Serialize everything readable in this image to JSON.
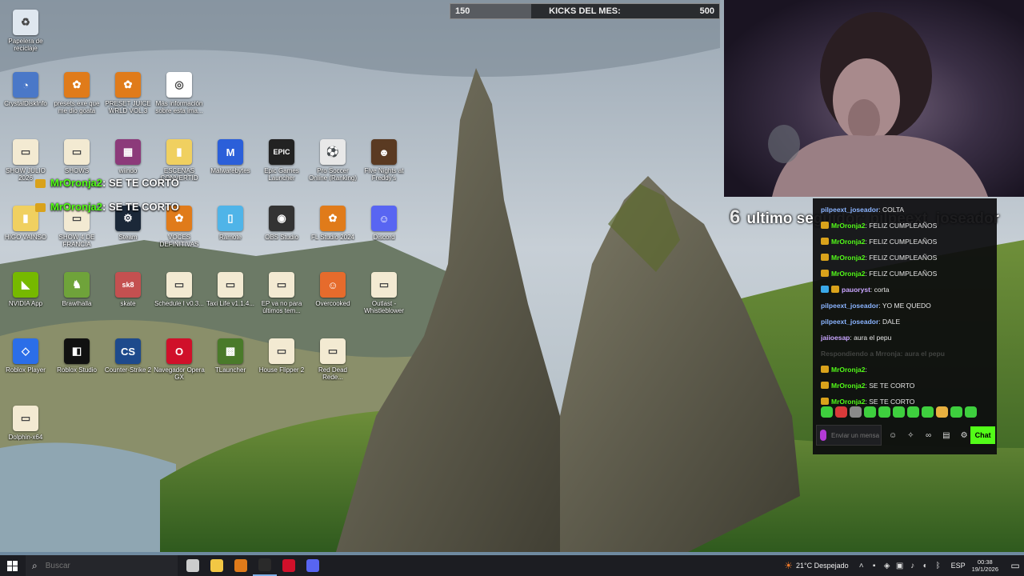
{
  "desktop": {
    "icons": [
      {
        "label": "Papelera de reciclaje",
        "icon": "recycle-bin-icon",
        "color": "#dfe7ef",
        "glyph": "♻"
      },
      {
        "label": "CrystalDiskInfo",
        "icon": "crystaldiskinfo-icon",
        "color": "#4a78c8",
        "glyph": "◔"
      },
      {
        "label": "presets.exe que me dio goata",
        "icon": "fl-studio-icon",
        "color": "#e07b1a",
        "glyph": "✿"
      },
      {
        "label": "PRESET JUICE WRLD VOL.3",
        "icon": "fl-studio-icon",
        "color": "#e07b1a",
        "glyph": "✿"
      },
      {
        "label": "Más información sobre esta ima...",
        "icon": "info-camera-icon",
        "color": "#ffffff",
        "glyph": "◎"
      },
      {
        "label": "SHOW JULIO 2026",
        "icon": "folder-icon",
        "color": "#f3ead2",
        "glyph": "▭"
      },
      {
        "label": "SHOWS",
        "icon": "folder-icon",
        "color": "#f3ead2",
        "glyph": "▭"
      },
      {
        "label": "wiindo",
        "icon": "winrar-icon",
        "color": "#8c3a7a",
        "glyph": "▦"
      },
      {
        "label": "ESCENAS CONVERTID",
        "icon": "folder-dark-icon",
        "color": "#f0d060",
        "glyph": "▮"
      },
      {
        "label": "Malwarebytes",
        "icon": "malwarebytes-icon",
        "color": "#2b5fd9",
        "glyph": "M"
      },
      {
        "label": "Epic Games Launcher",
        "icon": "epic-games-icon",
        "color": "#222222",
        "glyph": "EPIC"
      },
      {
        "label": "Pro Soccer Online (Ranking)",
        "icon": "soccer-ball-icon",
        "color": "#e8e8e8",
        "glyph": "⚽"
      },
      {
        "label": "Five Nights at Freddy's",
        "icon": "fnaf-icon",
        "color": "#5a3a22",
        "glyph": "☻"
      },
      {
        "label": "HIGO VAINSO",
        "icon": "folder-dark-icon",
        "color": "#f0d060",
        "glyph": "▮"
      },
      {
        "label": "SHOW 4 DE FRANCIA",
        "icon": "folder-icon",
        "color": "#f3ead2",
        "glyph": "▭"
      },
      {
        "label": "Steam",
        "icon": "steam-icon",
        "color": "#1b2838",
        "glyph": "⚙"
      },
      {
        "label": "VOCES DEFINITIVAS",
        "icon": "fl-studio-icon",
        "color": "#e07b1a",
        "glyph": "✿"
      },
      {
        "label": "Ramote",
        "icon": "app-icon",
        "color": "#4fb4e8",
        "glyph": "▯"
      },
      {
        "label": "OBS Studio",
        "icon": "obs-icon",
        "color": "#333333",
        "glyph": "◉"
      },
      {
        "label": "FL Studio 2024",
        "icon": "fl-studio-icon",
        "color": "#e07b1a",
        "glyph": "✿"
      },
      {
        "label": "Discord",
        "icon": "discord-icon",
        "color": "#5865f2",
        "glyph": "☺"
      },
      {
        "label": "NVIDIA App",
        "icon": "nvidia-icon",
        "color": "#76b900",
        "glyph": "◣"
      },
      {
        "label": "Brawlhalla",
        "icon": "brawlhalla-icon",
        "color": "#6fa33a",
        "glyph": "♞"
      },
      {
        "label": "skate",
        "icon": "skate-icon",
        "color": "#c45050",
        "glyph": "sk8"
      },
      {
        "label": "Schedule I v0.3...",
        "icon": "folder-icon",
        "color": "#f3ead2",
        "glyph": "▭"
      },
      {
        "label": "Taxi Life v1.1.4...",
        "icon": "folder-icon",
        "color": "#f3ead2",
        "glyph": "▭"
      },
      {
        "label": "EP va no para últimos tem...",
        "icon": "folder-icon",
        "color": "#f3ead2",
        "glyph": "▭"
      },
      {
        "label": "Overcooked",
        "icon": "overcooked-icon",
        "color": "#e66b2c",
        "glyph": "☺"
      },
      {
        "label": "Outlast - Whistleblower",
        "icon": "folder-icon",
        "color": "#f3ead2",
        "glyph": "▭"
      },
      {
        "label": "Roblox Player",
        "icon": "roblox-player-icon",
        "color": "#2b6ee8",
        "glyph": "◇"
      },
      {
        "label": "Roblox Studio",
        "icon": "roblox-studio-icon",
        "color": "#111111",
        "glyph": "◧"
      },
      {
        "label": "Counter-Strike 2",
        "icon": "counter-strike-icon",
        "color": "#1e4a8c",
        "glyph": "CS"
      },
      {
        "label": "Navegador Opera GX",
        "icon": "opera-gx-icon",
        "color": "#d0102a",
        "glyph": "O"
      },
      {
        "label": "TLauncher",
        "icon": "tlauncher-icon",
        "color": "#4a7a2a",
        "glyph": "▩"
      },
      {
        "label": "House Flipper 2",
        "icon": "folder-icon",
        "color": "#f3ead2",
        "glyph": "▭"
      },
      {
        "label": "Red Dead Rede...",
        "icon": "folder-icon",
        "color": "#f3ead2",
        "glyph": "▭"
      },
      {
        "label": "Dolphin-x64",
        "icon": "folder-icon",
        "color": "#f3ead2",
        "glyph": "▭"
      }
    ]
  },
  "overlay": {
    "kicks": {
      "current": "150",
      "title": "KICKS DEL MES:",
      "goal": "500",
      "progress": 0.3
    },
    "follower_ticker": {
      "count": "6",
      "text": "ultimo seguidor: pilpeext_joseador"
    },
    "alerts": [
      {
        "user": "MrOronja2",
        "message": ": SE TE CORTO"
      },
      {
        "user": "MrOronja2",
        "message": ": SE TE CORTO"
      }
    ]
  },
  "chat": {
    "messages": [
      {
        "user": "pilpeext_joseador",
        "text": ": COLTA",
        "user_color": "#8ab4ff",
        "badges": []
      },
      {
        "user": "MrOronja2",
        "text": ": FELIZ CUMPLEAÑOS",
        "user_color": "#53fc18",
        "badges": [
          "#d9a21b"
        ]
      },
      {
        "user": "MrOronja2",
        "text": ": FELIZ CUMPLEAÑOS",
        "user_color": "#53fc18",
        "badges": [
          "#d9a21b"
        ]
      },
      {
        "user": "MrOronja2",
        "text": ": FELIZ CUMPLEAÑOS",
        "user_color": "#53fc18",
        "badges": [
          "#d9a21b"
        ]
      },
      {
        "user": "MrOronja2",
        "text": ": FELIZ CUMPLEAÑOS",
        "user_color": "#53fc18",
        "badges": [
          "#d9a21b"
        ]
      },
      {
        "user": "pauoryst",
        "text": ": corta",
        "user_color": "#c9a6ff",
        "badges": [
          "#3aa8e8",
          "#d9a21b"
        ]
      },
      {
        "user": "pilpeext_joseador",
        "text": ": YO ME QUEDO",
        "user_color": "#8ab4ff",
        "badges": []
      },
      {
        "user": "pilpeext_joseador",
        "text": ": DALE",
        "user_color": "#8ab4ff",
        "badges": []
      },
      {
        "user": "jaiioesap",
        "text": ": aura el pepu",
        "user_color": "#c9a6ff",
        "badges": []
      },
      {
        "user": "Respondiendo a Mrronja: aura el pepu",
        "text": "",
        "user_color": "#9a9a9a",
        "badges": [],
        "faded": true
      },
      {
        "user": "MrOronja2",
        "text": ":",
        "user_color": "#53fc18",
        "badges": [
          "#d9a21b"
        ]
      },
      {
        "user": "MrOronja2",
        "text": ": SE TE CORTO",
        "user_color": "#53fc18",
        "badges": [
          "#d9a21b"
        ]
      },
      {
        "user": "MrOronja2",
        "text": ": SE TE CORTO",
        "user_color": "#53fc18",
        "badges": [
          "#d9a21b"
        ]
      }
    ],
    "emote_colors": [
      "#3ecf3e",
      "#d93a3a",
      "#8a8a8a",
      "#3ecf3e",
      "#3ecf3e",
      "#3ecf3e",
      "#3ecf3e",
      "#3ecf3e",
      "#e8b040",
      "#3ecf3e",
      "#3ecf3e"
    ],
    "input_placeholder": "Enviar un mensaje",
    "send_label": "Chat"
  },
  "taskbar": {
    "search_placeholder": "Buscar",
    "weather": "21°C Despejado",
    "language": "ESP",
    "time": "00:38",
    "date": "19/1/2026",
    "apps": [
      {
        "icon": "task-view-icon",
        "color": "#cccccc"
      },
      {
        "icon": "file-explorer-icon",
        "color": "#f2c744"
      },
      {
        "icon": "fl-studio-icon",
        "color": "#e07b1a"
      },
      {
        "icon": "obs-studio-icon",
        "color": "#2a2a2a"
      },
      {
        "icon": "opera-gx-icon",
        "color": "#d0102a"
      },
      {
        "icon": "discord-icon",
        "color": "#5865f2"
      }
    ]
  }
}
